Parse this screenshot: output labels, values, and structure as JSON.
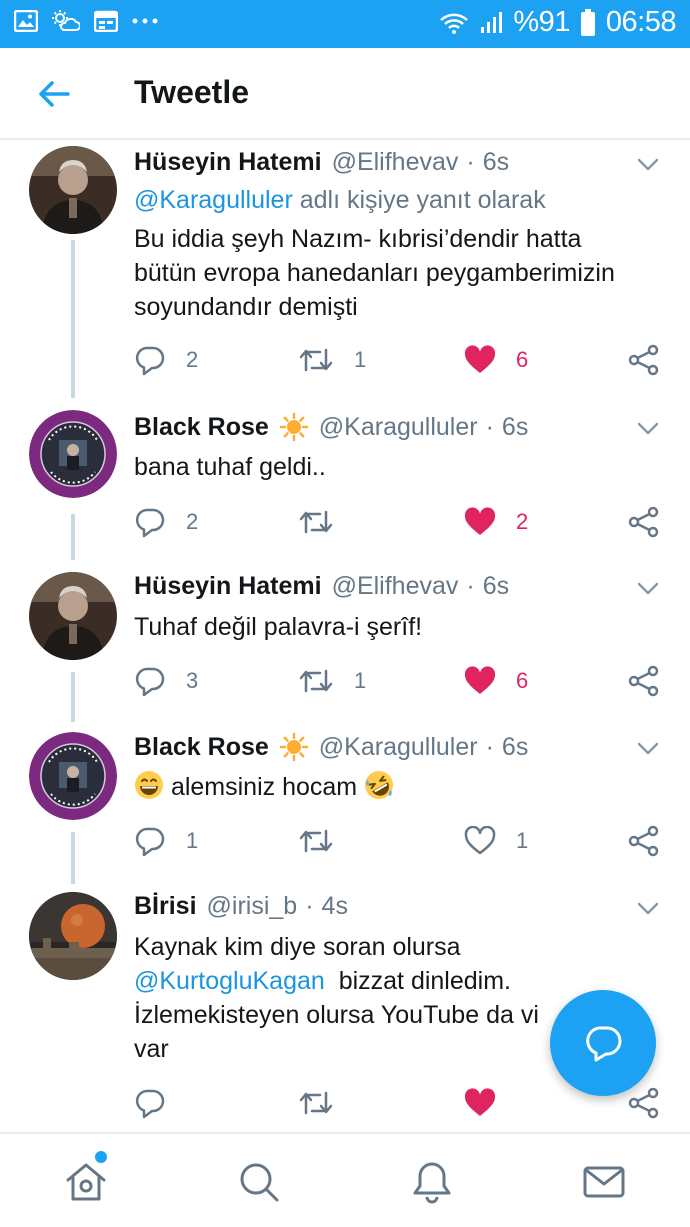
{
  "status_bar": {
    "battery": "%91",
    "time": "06:58",
    "icons": [
      "gallery-icon",
      "weather-icon",
      "calendar-icon",
      "more-dots-icon",
      "wifi-icon",
      "signal-icon",
      "battery-icon"
    ]
  },
  "app_bar": {
    "title": "Tweetle",
    "back_icon": "back-arrow-icon"
  },
  "tweets": [
    {
      "name": "Hüseyin Hatemi",
      "handle": "@Elifhevav",
      "dot": "·",
      "time": "6s",
      "reply_prefix": "@Karagulluler",
      "reply_suffix": " adlı kişiye yanıt olarak",
      "lines": [
        "Bu iddia şeyh Nazım- kıbrisi’dendir hatta",
        "bütün evropa hanedanları peygamberimizin",
        "soyundandır demişti"
      ],
      "replies": "2",
      "retweets": "1",
      "likes": "6",
      "liked": true
    },
    {
      "name": "Black Rose",
      "handle": "@Karagulluler",
      "dot": "·",
      "time": "6s",
      "lines": [
        "bana tuhaf geldi.."
      ],
      "replies": "2",
      "retweets": "",
      "likes": "2",
      "liked": true
    },
    {
      "name": "Hüseyin Hatemi",
      "handle": "@Elifhevav",
      "dot": "·",
      "time": "6s",
      "lines": [
        "Tuhaf değil palavra-i şerîf!"
      ],
      "replies": "3",
      "retweets": "1",
      "likes": "6",
      "liked": true
    },
    {
      "name": "Black Rose",
      "handle": "@Karagulluler",
      "dot": "·",
      "time": "6s",
      "text_main": " alemsiniz hocam ",
      "replies": "1",
      "retweets": "",
      "likes": "1",
      "liked": false
    },
    {
      "name": "Bİrisi",
      "handle": "@irisi_b",
      "dot": "·",
      "time": "4s",
      "line1": "Kaynak kim diye soran olursa",
      "line2_mention": "@KurtogluKagan",
      "line2_rest": "  bizzat dinledim.",
      "line3": "İzlemekisteyen olursa YouTube da vi",
      "line4": "var",
      "replies": "",
      "retweets": "",
      "likes": "",
      "liked": true
    }
  ],
  "colors": {
    "accent": "#1da1f2",
    "like": "#e0245e",
    "muted": "#657786",
    "text": "#14171a",
    "divider": "#e6ecf0"
  },
  "bottom_nav": [
    "home-icon",
    "search-icon",
    "notifications-icon",
    "messages-icon"
  ]
}
